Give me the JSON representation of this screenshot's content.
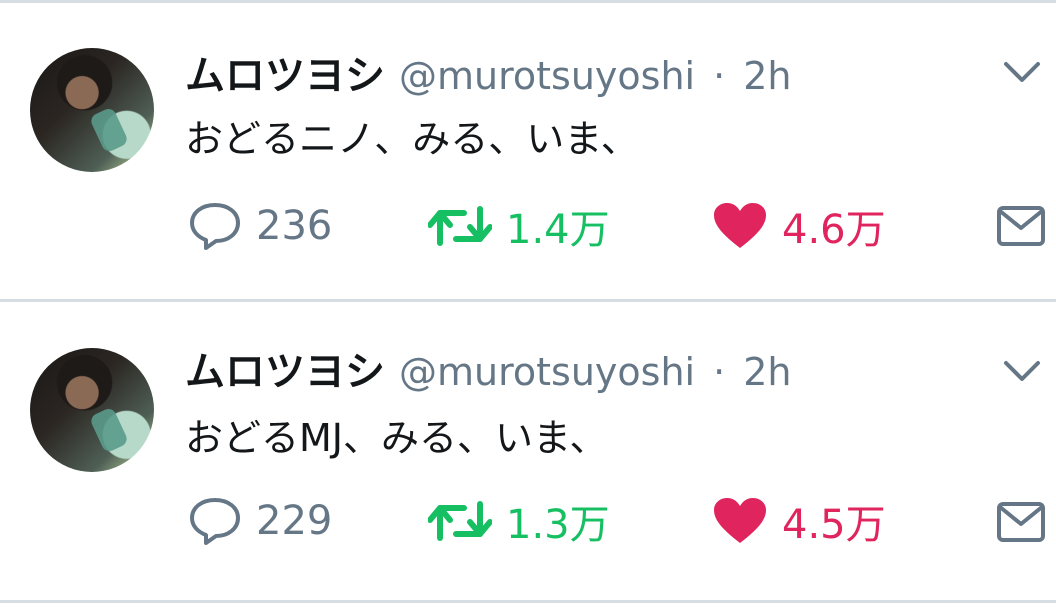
{
  "tweets": [
    {
      "name": "ムロツヨシ",
      "handle": "@murotsuyoshi",
      "separator": "·",
      "time": "2h",
      "text": "おどるニノ、みる、いま、",
      "reply_count": "236",
      "retweet_count": "1.4万",
      "like_count": "4.6万"
    },
    {
      "name": "ムロツヨシ",
      "handle": "@murotsuyoshi",
      "separator": "·",
      "time": "2h",
      "text": "おどるMJ、みる、いま、",
      "reply_count": "229",
      "retweet_count": "1.3万",
      "like_count": "4.5万"
    }
  ],
  "colors": {
    "reply": "#657786",
    "retweet": "#17bf63",
    "like": "#e0245e",
    "divider": "#d6dde3"
  },
  "icons": [
    "avatar-photo",
    "chevron-down-icon",
    "reply-icon",
    "retweet-icon",
    "heart-icon",
    "mail-icon"
  ]
}
